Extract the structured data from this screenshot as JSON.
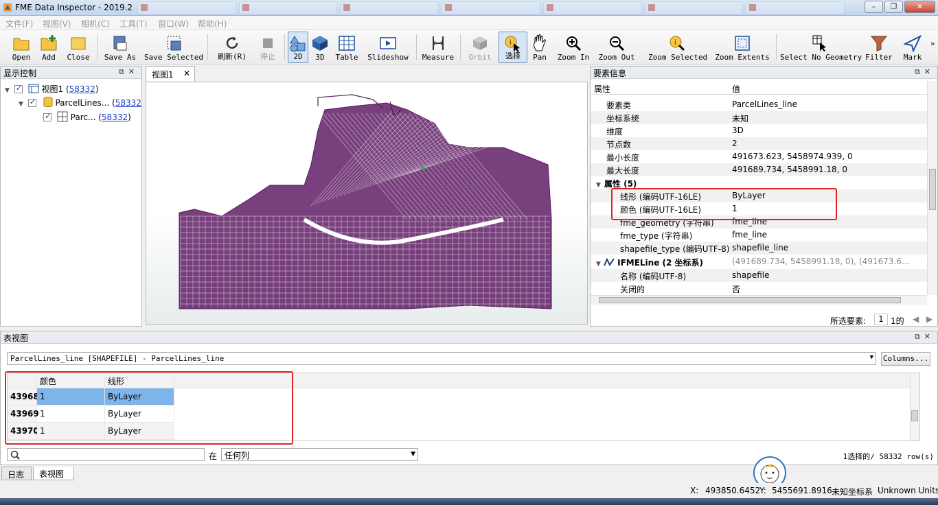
{
  "window": {
    "title": "FME Data Inspector - 2019.2",
    "minimize": "–",
    "maximize": "❐",
    "close": "✕"
  },
  "menu": [
    "文件(F)",
    "视图(V)",
    "相机(C)",
    "工具(T)",
    "窗口(W)",
    "帮助(H)"
  ],
  "toolbar": {
    "open": "Open",
    "add": "Add",
    "close": "Close",
    "save_as": "Save As",
    "save_selected": "Save Selected",
    "refresh": "刷新(R)",
    "stop": "停止",
    "view2d": "2D",
    "view3d": "3D",
    "table": "Table",
    "slideshow": "Slideshow",
    "measure": "Measure",
    "orbit": "Orbit",
    "select": "选择",
    "pan": "Pan",
    "zoom_in": "Zoom In",
    "zoom_out": "Zoom Out",
    "zoom_selected": "Zoom Selected",
    "zoom_extents": "Zoom Extents",
    "select_no_geometry": "Select No Geometry",
    "filter": "Filter",
    "mark": "Mark",
    "more": "»"
  },
  "display_control": {
    "title": "显示控制",
    "items": [
      {
        "label": "视图1 (",
        "count": "58332",
        "suffix": ")"
      },
      {
        "label": "ParcelLines... (",
        "count": "58332",
        "suffix": ""
      },
      {
        "label": "Parc... (",
        "count": "58332",
        "suffix": ")"
      }
    ]
  },
  "viewer": {
    "tab": "视图1",
    "close": "✕"
  },
  "feature_info": {
    "title": "要素信息",
    "col_attr": "属性",
    "col_value": "值",
    "rows": [
      {
        "k": "要素类",
        "v": "ParcelLines_line"
      },
      {
        "k": "坐标系统",
        "v": "未知"
      },
      {
        "k": "维度",
        "v": "3D"
      },
      {
        "k": "节点数",
        "v": "2"
      },
      {
        "k": "最小长度",
        "v": "491673.623, 5458974.939, 0"
      },
      {
        "k": "最大长度",
        "v": "491689.734, 5458991.18, 0"
      }
    ],
    "attr_section": "属性 (5)",
    "attr_rows": [
      {
        "k": "线形 (编码UTF-16LE)",
        "v": "ByLayer"
      },
      {
        "k": "颜色 (编码UTF-16LE)",
        "v": "1"
      },
      {
        "k": "fme_geometry (字符串)",
        "v": "fme_line"
      },
      {
        "k": "fme_type (字符串)",
        "v": "fme_line"
      },
      {
        "k": "shapefile_type (编码UTF-8)",
        "v": "shapefile_line"
      }
    ],
    "geom_section": "IFMELine (2 坐标系)",
    "geom_value": "(491689.734, 5458991.18, 0), (491673.6...",
    "geom_rows": [
      {
        "k": "名称 (编码UTF-8)",
        "v": "shapefile"
      },
      {
        "k": "关闭的",
        "v": "否"
      }
    ],
    "selected_label": "所选要素:",
    "selected_value": "1",
    "selected_of": "1的"
  },
  "table_view": {
    "title": "表视图",
    "dataset": "ParcelLines_line [SHAPEFILE] - ParcelLines_line",
    "columns_button": "Columns...",
    "headers": [
      "颜色",
      "线形"
    ],
    "rows": [
      {
        "id": "43968",
        "color": "1",
        "linetype": "ByLayer"
      },
      {
        "id": "43969",
        "color": "1",
        "linetype": "ByLayer"
      },
      {
        "id": "43970",
        "color": "1",
        "linetype": "ByLayer"
      }
    ],
    "search_placeholder": "",
    "in_label": "在",
    "column_choice": "任何列",
    "selection_count": "1选择的/ 58332 row(s)"
  },
  "bottom_tabs": [
    "日志",
    "表视图"
  ],
  "status": {
    "x_label": "X:",
    "x_value": "493850.6452",
    "y_label": "Y:",
    "y_value": "5455691.8916",
    "crs": "未知坐标系",
    "units": "Unknown Units"
  },
  "colors": {
    "parcels": "#5a1660",
    "highlight": "#e02424",
    "selection": "#7eb4ea"
  }
}
